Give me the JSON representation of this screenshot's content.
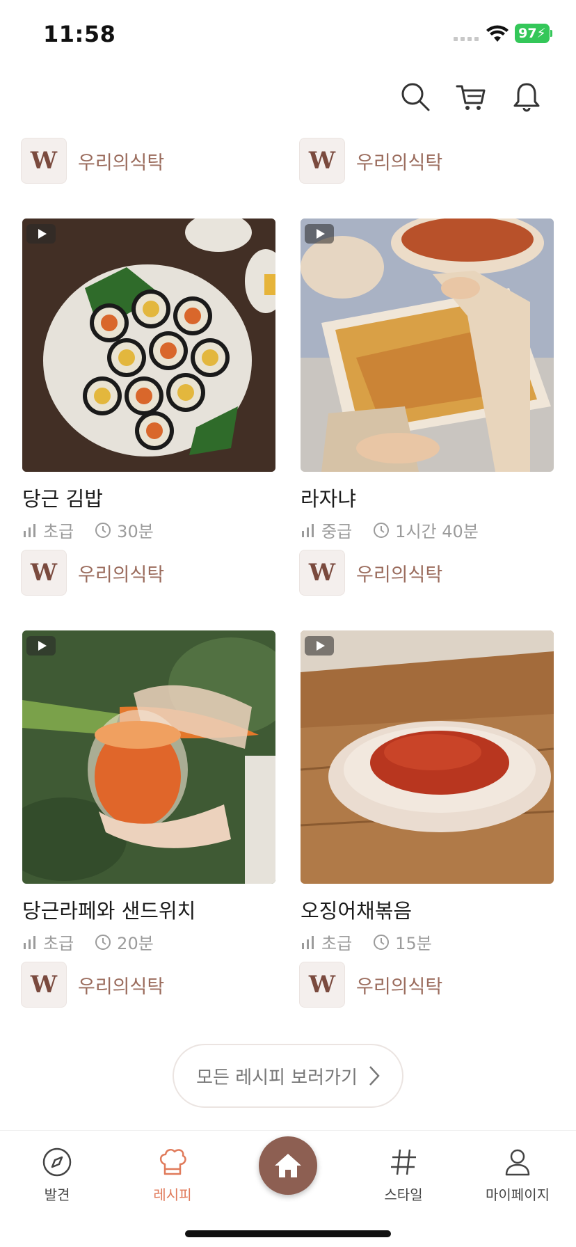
{
  "status_bar": {
    "time": "11:58",
    "battery": "97"
  },
  "header": {
    "icons": [
      "search-icon",
      "cart-icon",
      "bell-icon"
    ]
  },
  "top_authors": [
    {
      "logo": "W",
      "name": "우리의식탁"
    },
    {
      "logo": "W",
      "name": "우리의식탁"
    }
  ],
  "recipes": [
    {
      "title": "당근 김밥",
      "level": "초급",
      "time": "30분",
      "author": "우리의식탁",
      "logo": "W"
    },
    {
      "title": "라자냐",
      "level": "중급",
      "time": "1시간 40분",
      "author": "우리의식탁",
      "logo": "W"
    },
    {
      "title": "당근라페와 샌드위치",
      "level": "초급",
      "time": "20분",
      "author": "우리의식탁",
      "logo": "W"
    },
    {
      "title": "오징어채볶음",
      "level": "초급",
      "time": "15분",
      "author": "우리의식탁",
      "logo": "W"
    }
  ],
  "view_all_label": "모든 레시피 보러가기",
  "tab_bar": {
    "tabs": [
      {
        "label": "발견",
        "icon": "compass-icon"
      },
      {
        "label": "레시피",
        "icon": "chef-hat-icon",
        "active": true
      },
      {
        "label": "",
        "icon": "home-icon"
      },
      {
        "label": "스타일",
        "icon": "hashtag-icon"
      },
      {
        "label": "마이페이지",
        "icon": "person-icon"
      }
    ]
  },
  "colors": {
    "accent": "#e07a5a",
    "brand": "#8d5f52",
    "author_text": "#9a6b5c"
  }
}
